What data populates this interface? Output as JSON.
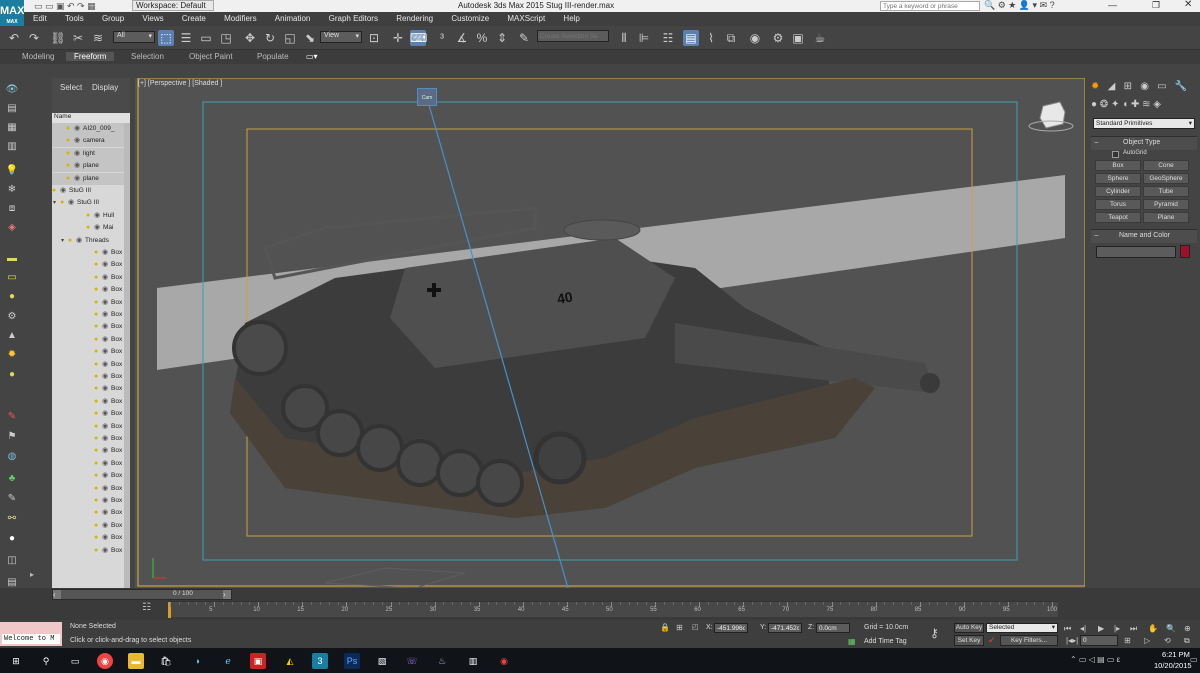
{
  "window": {
    "title": "Autodesk 3ds Max 2015    Stug III-render.max",
    "workspace_label": "Workspace: Default",
    "search_placeholder": "Type a keyword or phrase",
    "logo": "MAX"
  },
  "menu": [
    "Edit",
    "Tools",
    "Group",
    "Views",
    "Create",
    "Modifiers",
    "Animation",
    "Graph Editors",
    "Rendering",
    "Customize",
    "MAXScript",
    "Help"
  ],
  "toolbar": {
    "selection_filter": "All",
    "reference_coord": "View",
    "named_selection_placeholder": "Create Selection Se"
  },
  "ribbon_tabs": [
    "Modeling",
    "Freeform",
    "Selection",
    "Object Paint",
    "Populate"
  ],
  "scene_explorer": {
    "tabs": [
      "Select",
      "Display"
    ],
    "column_header": "Name",
    "items": [
      "AI20_009_",
      "camera",
      "light",
      "plane",
      "plane",
      "StuG III",
      "StuG III",
      "Hull",
      "Mai",
      "Threads",
      "Box",
      "Box",
      "Box",
      "Box",
      "Box",
      "Box",
      "Box",
      "Box",
      "Box",
      "Box",
      "Box",
      "Box",
      "Box",
      "Box",
      "Box",
      "Box",
      "Box",
      "Box",
      "Box",
      "Box",
      "Box",
      "Box",
      "Box",
      "Box",
      "Box"
    ]
  },
  "viewport": {
    "label": "[+] [Perspective ] [Shaded ]",
    "camera_label": "Cam",
    "hull_number": "40"
  },
  "command_panel": {
    "category": "Standard Primitives",
    "object_type_title": "Object Type",
    "autogrid_label": "AutoGrid",
    "buttons": [
      "Box",
      "Cone",
      "Sphere",
      "GeoSphere",
      "Cylinder",
      "Tube",
      "Torus",
      "Pyramid",
      "Teapot",
      "Plane"
    ],
    "name_color_title": "Name and Color",
    "swatch_color": "#a0102a"
  },
  "timeline": {
    "frame_counter": "0 / 100",
    "ticks": [
      "0",
      "5",
      "10",
      "15",
      "20",
      "25",
      "30",
      "35",
      "40",
      "45",
      "50",
      "55",
      "60",
      "65",
      "70",
      "75",
      "80",
      "85",
      "90",
      "95",
      "100"
    ]
  },
  "status": {
    "maxscript_listener": "Welcome to M",
    "selection_status": "None Selected",
    "prompt": "Click or click-and-drag to select objects",
    "x_label": "X:",
    "x_value": "-451.996c",
    "y_label": "Y:",
    "y_value": "-471.452c",
    "z_label": "Z:",
    "z_value": "0.0cm",
    "grid": "Grid = 10.0cm",
    "add_time_tag": "Add Time Tag",
    "auto_key": "Auto Key",
    "set_key": "Set Key",
    "key_mode": "Selected",
    "key_filters": "Key Filters...",
    "current_frame": "0"
  },
  "taskbar": {
    "time": "6:21 PM",
    "date": "10/20/2015"
  },
  "colors": {
    "accent": "#5b7fae",
    "safe_frame_outer": "#c8a040",
    "safe_frame_action": "#3aa0b0",
    "viewport_bg": "#525252"
  }
}
